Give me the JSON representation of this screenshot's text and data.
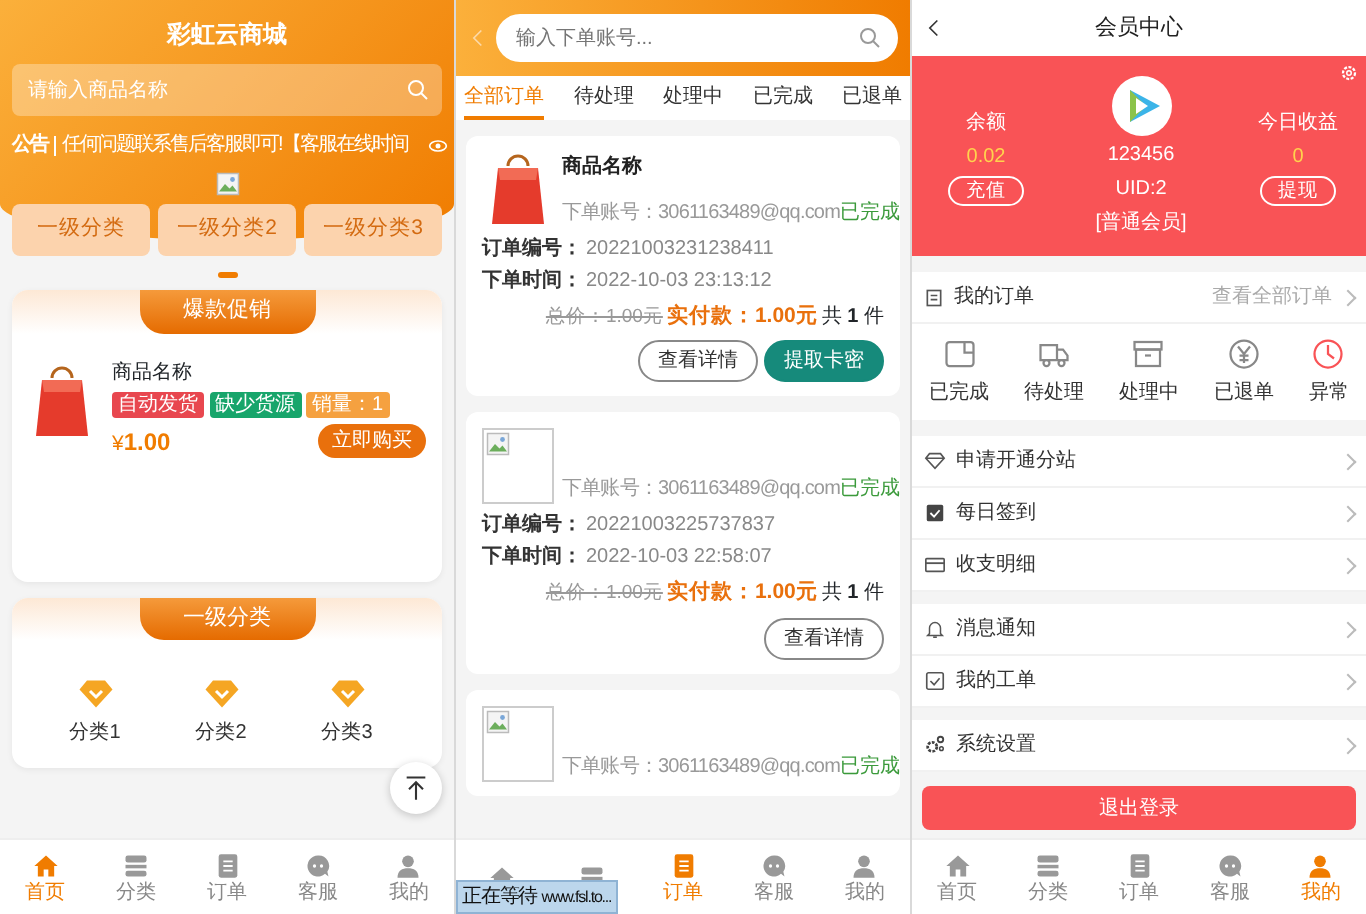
{
  "home": {
    "title": "彩虹云商城",
    "search": {
      "placeholder": "请输入商品名称"
    },
    "notice": {
      "label": "公告",
      "text": "任何问题联系售后客服即可!【客服在线时间"
    },
    "categories": [
      {
        "label": "一级分类"
      },
      {
        "label": "一级分类2"
      },
      {
        "label": "一级分类3"
      }
    ],
    "promo": {
      "title": "爆款促销",
      "product": {
        "name": "商品名称",
        "tags": [
          {
            "text": "自动发货",
            "color": "#e8474f"
          },
          {
            "text": "缺少货源",
            "color": "#17a56b"
          },
          {
            "text": "销量：1",
            "color": "#f5a140"
          }
        ],
        "currency": "¥",
        "price": "1.00",
        "buy": "立即购买"
      }
    },
    "category_section": {
      "title": "一级分类",
      "items": [
        "分类1",
        "分类2",
        "分类3"
      ]
    },
    "nav": [
      {
        "kind": "home",
        "label": "首页",
        "selected": true
      },
      {
        "kind": "category",
        "label": "分类",
        "selected": false
      },
      {
        "kind": "order",
        "label": "订单",
        "selected": false
      },
      {
        "kind": "service",
        "label": "客服",
        "selected": false
      },
      {
        "kind": "me",
        "label": "我的",
        "selected": false
      }
    ]
  },
  "orders": {
    "search": {
      "placeholder": "输入下单账号..."
    },
    "tabs": [
      {
        "label": "全部订单",
        "selected": true
      },
      {
        "label": "待处理",
        "selected": false
      },
      {
        "label": "处理中",
        "selected": false
      },
      {
        "label": "已完成",
        "selected": false
      },
      {
        "label": "已退单",
        "selected": false
      }
    ],
    "items": [
      {
        "kind": "sale",
        "name": "商品名称",
        "account": "下单账号：3061163489@qq.com",
        "status": "已完成",
        "order_no_label": "订单编号：",
        "order_no": "20221003231238411",
        "time_label": "下单时间：",
        "time": "2022-10-03 23:13:12",
        "total": "总价：1.00元",
        "paid": "实付款：1.00元",
        "count": "共 **1** 件",
        "buttons": [
          {
            "label": "查看详情",
            "kind": "outline"
          },
          {
            "label": "提取卡密",
            "kind": "primary"
          }
        ]
      },
      {
        "kind": "broken",
        "account": "下单账号：3061163489@qq.com",
        "status": "已完成",
        "order_no_label": "订单编号：",
        "order_no": "20221003225737837",
        "time_label": "下单时间：",
        "time": "2022-10-03 22:58:07",
        "total": "总价：1.00元",
        "paid": "实付款：1.00元",
        "count": "共 **1** 件",
        "buttons": [
          {
            "label": "查看详情",
            "kind": "outline"
          }
        ]
      },
      {
        "kind": "broken",
        "account": "下单账号：3061163489@qq.com",
        "status": "已完成"
      }
    ],
    "nav": [
      {
        "kind": "home",
        "selected": false
      },
      {
        "kind": "category",
        "selected": false
      },
      {
        "kind": "order",
        "label": "订单",
        "selected": true
      },
      {
        "kind": "service",
        "label": "客服",
        "selected": false
      },
      {
        "kind": "me",
        "label": "我的",
        "selected": false
      }
    ],
    "status_bar": "正在等待 www.fsl.to..."
  },
  "member": {
    "title": "会员中心",
    "balance_label": "余额",
    "balance": "0.02",
    "recharge": "充值",
    "username": "123456",
    "uid": "UID:2",
    "level": "[普通会员]",
    "income_label": "今日收益",
    "income": "0",
    "withdraw": "提现",
    "orders_title": "我的订单",
    "view_all": "查看全部订单",
    "order_states": [
      {
        "kind": "done",
        "label": "已完成"
      },
      {
        "kind": "pending",
        "label": "待处理"
      },
      {
        "kind": "processing",
        "label": "处理中"
      },
      {
        "kind": "refunded",
        "label": "已退单"
      },
      {
        "kind": "error",
        "label": "异常"
      }
    ],
    "menu_groups": [
      [
        {
          "kind": "gem",
          "label": "申请开通分站"
        },
        {
          "kind": "checkin",
          "label": "每日签到"
        },
        {
          "kind": "card",
          "label": "收支明细"
        }
      ],
      [
        {
          "kind": "bell",
          "label": "消息通知"
        },
        {
          "kind": "ticket",
          "label": "我的工单"
        }
      ],
      [
        {
          "kind": "settings",
          "label": "系统设置"
        }
      ]
    ],
    "logout": "退出登录",
    "nav": [
      {
        "kind": "home",
        "label": "首页",
        "selected": false
      },
      {
        "kind": "category",
        "label": "分类",
        "selected": false
      },
      {
        "kind": "order",
        "label": "订单",
        "selected": false
      },
      {
        "kind": "service",
        "label": "客服",
        "selected": false
      },
      {
        "kind": "me",
        "label": "我的",
        "selected": true
      }
    ]
  }
}
